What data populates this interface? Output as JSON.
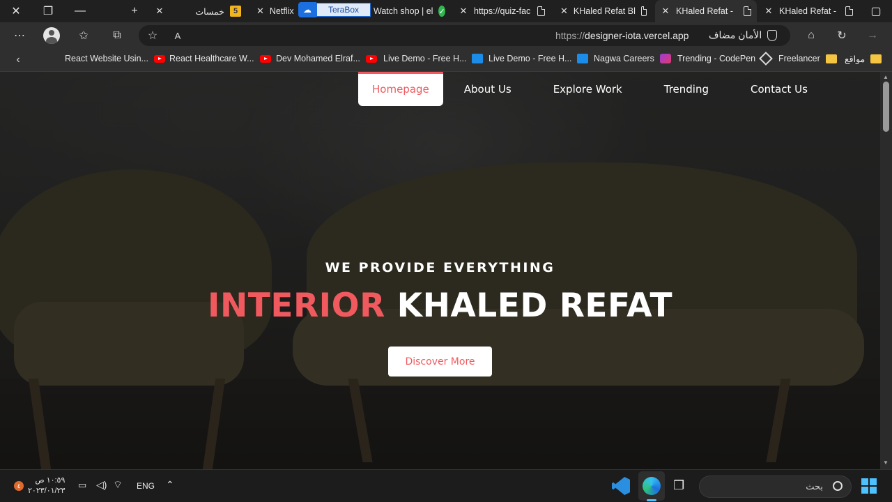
{
  "browser": {
    "tabs": [
      {
        "title": "خمسات",
        "badge": "5"
      },
      {
        "title": "Netflix"
      },
      {
        "title": "Watch shop | el"
      },
      {
        "title": "https://quiz-fac"
      },
      {
        "title": "KHaled Refat Bl"
      },
      {
        "title": "KHaled Refat -"
      },
      {
        "title": "KHaled Refat -"
      }
    ],
    "terabox_label": "TeraBox",
    "address": {
      "scheme": "https://",
      "host": "designer-iota.vercel.app",
      "security_label": "الأمان مضاف"
    },
    "bookmarks": [
      {
        "label": "React Website Usin...",
        "icon": "youtube-icon"
      },
      {
        "label": "React Healthcare W...",
        "icon": "youtube-icon"
      },
      {
        "label": "Dev Mohamed Elraf...",
        "icon": "youtube-icon"
      },
      {
        "label": "Live Demo - Free H...",
        "icon": "site-icon"
      },
      {
        "label": "Live Demo - Free H...",
        "icon": "site-icon"
      },
      {
        "label": "Nagwa Careers",
        "icon": "nagwa-icon"
      },
      {
        "label": "Trending - CodePen",
        "icon": "codepen-icon"
      },
      {
        "label": "Freelancer",
        "icon": "folder-icon"
      },
      {
        "label": "مواقع",
        "icon": "folder-icon"
      }
    ]
  },
  "page": {
    "nav": [
      {
        "label": "Homepage",
        "active": true
      },
      {
        "label": "About Us"
      },
      {
        "label": "Explore Work"
      },
      {
        "label": "Trending"
      },
      {
        "label": "Contact Us"
      }
    ],
    "kicker": "WE PROVIDE EVERYTHING",
    "headline_accent": "INTERIOR",
    "headline_rest": "KHALED REFAT",
    "cta_label": "Discover More",
    "accent_color": "#f05a5f"
  },
  "taskbar": {
    "search_placeholder": "بحث",
    "language": "ENG",
    "time": "١٠:٥٩ ص",
    "date": "٢٠٢٣/٠١/٢٣",
    "notification_count": "٤"
  }
}
